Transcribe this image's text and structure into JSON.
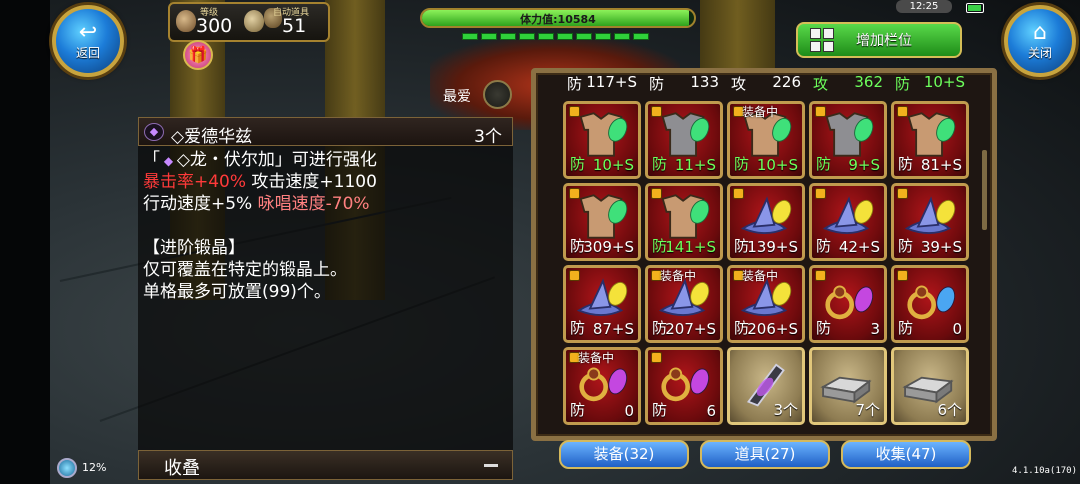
{
  "nav": {
    "back_label": "返回",
    "close_label": "关闭"
  },
  "player": {
    "level_label": "等级",
    "level": "300",
    "auto_item_label": "自动道具",
    "auto_item_count": "51"
  },
  "stamina": {
    "text": "体力值:10584",
    "fill_fraction": 0.98,
    "segments": 10
  },
  "status_bar": {
    "time": "12:25",
    "battery_fraction": 0.8,
    "network_percent": "12%",
    "version": "4.1.10a(170)"
  },
  "add_slot": {
    "label": "增加栏位"
  },
  "favorite": {
    "label": "最爱"
  },
  "item": {
    "name": "◇爱德华兹",
    "count": "3个",
    "lines": [
      {
        "parts": [
          {
            "text": "「",
            "color": "white"
          },
          {
            "text": "◇龙・伏尔加」可进行强化",
            "color": "white"
          }
        ]
      },
      {
        "parts": [
          {
            "text": "暴击率+40%",
            "color": "red"
          },
          {
            "text": " 攻击速度+1100",
            "color": "white"
          }
        ]
      },
      {
        "parts": [
          {
            "text": "行动速度+5%",
            "color": "white"
          },
          {
            "text": " 咏唱速度-70%",
            "color": "pink"
          }
        ]
      },
      {
        "parts": [
          {
            "text": "",
            "color": "white"
          }
        ]
      },
      {
        "parts": [
          {
            "text": "【进阶锻晶】",
            "color": "white"
          }
        ]
      },
      {
        "parts": [
          {
            "text": "仅可覆盖在特定的锻晶上。",
            "color": "white"
          }
        ]
      },
      {
        "parts": [
          {
            "text": "单格最多可放置(99)个。",
            "color": "white"
          }
        ]
      }
    ]
  },
  "collapse": {
    "label": "收叠"
  },
  "inventory": {
    "partial_row": [
      {
        "label": "防",
        "value": "117+S",
        "green": false
      },
      {
        "label": "防",
        "value": "133",
        "green": false
      },
      {
        "label": "攻",
        "value": "226",
        "green": false
      },
      {
        "label": "攻",
        "value": "362",
        "green": true
      },
      {
        "label": "防",
        "value": "10+S",
        "green": true
      }
    ],
    "rows": [
      [
        {
          "art": "armor-leaf",
          "locked": true,
          "equipped": "",
          "label": "防",
          "value": "10+S",
          "green": true
        },
        {
          "art": "chainmail-leaf",
          "locked": true,
          "equipped": "",
          "label": "防",
          "value": "11+S",
          "green": true
        },
        {
          "art": "armor-leaf",
          "locked": true,
          "equipped": "装备中",
          "label": "防",
          "value": "10+S",
          "green": true
        },
        {
          "art": "chainmail-leaf",
          "locked": true,
          "equipped": "",
          "label": "防",
          "value": "9+S",
          "green": true
        },
        {
          "art": "armor-leaf",
          "locked": true,
          "equipped": "",
          "label": "防",
          "value": "81+S",
          "green": false
        }
      ],
      [
        {
          "art": "armor-leaf",
          "locked": true,
          "equipped": "",
          "label": "防",
          "value": "309+S",
          "green": false
        },
        {
          "art": "armor-leaf",
          "locked": true,
          "equipped": "",
          "label": "防",
          "value": "141+S",
          "green": true
        },
        {
          "art": "hat-yellow",
          "locked": true,
          "equipped": "",
          "label": "防",
          "value": "139+S",
          "green": false
        },
        {
          "art": "hat-yellow",
          "locked": true,
          "equipped": "",
          "label": "防",
          "value": "42+S",
          "green": false
        },
        {
          "art": "hat-yellow",
          "locked": true,
          "equipped": "",
          "label": "防",
          "value": "39+S",
          "green": false
        }
      ],
      [
        {
          "art": "hat-yellow",
          "locked": true,
          "equipped": "",
          "label": "防",
          "value": "87+S",
          "green": false
        },
        {
          "art": "hat-yellow",
          "locked": true,
          "equipped": "装备中",
          "label": "防",
          "value": "207+S",
          "green": false
        },
        {
          "art": "hat-yellow",
          "locked": true,
          "equipped": "装备中",
          "label": "防",
          "value": "206+S",
          "green": false
        },
        {
          "art": "ring-purple",
          "locked": true,
          "equipped": "",
          "label": "防",
          "value": "3",
          "green": false
        },
        {
          "art": "ring-blue",
          "locked": true,
          "equipped": "",
          "label": "防",
          "value": "0",
          "green": false
        }
      ],
      [
        {
          "art": "ring-purple",
          "locked": true,
          "equipped": "装备中",
          "label": "防",
          "value": "0",
          "green": false
        },
        {
          "art": "ring-purple",
          "locked": true,
          "equipped": "",
          "label": "防",
          "value": "6",
          "green": false
        },
        {
          "art": "gem-crystal",
          "locked": false,
          "equipped": "",
          "label": "",
          "value": "3个",
          "green": false,
          "owned": true
        },
        {
          "art": "ingot",
          "locked": false,
          "equipped": "",
          "label": "",
          "value": "7个",
          "green": false,
          "owned": true
        },
        {
          "art": "ingot",
          "locked": false,
          "equipped": "",
          "label": "",
          "value": "6个",
          "green": false,
          "owned": true
        }
      ]
    ]
  },
  "tabs": [
    {
      "label": "装备(32)"
    },
    {
      "label": "道具(27)"
    },
    {
      "label": "收集(47)"
    }
  ],
  "colors": {
    "panel_red": "#b0151a",
    "gold_border": "#c09b4e",
    "tab_blue": "#1f5fc5",
    "add_green": "#1e8c18"
  }
}
